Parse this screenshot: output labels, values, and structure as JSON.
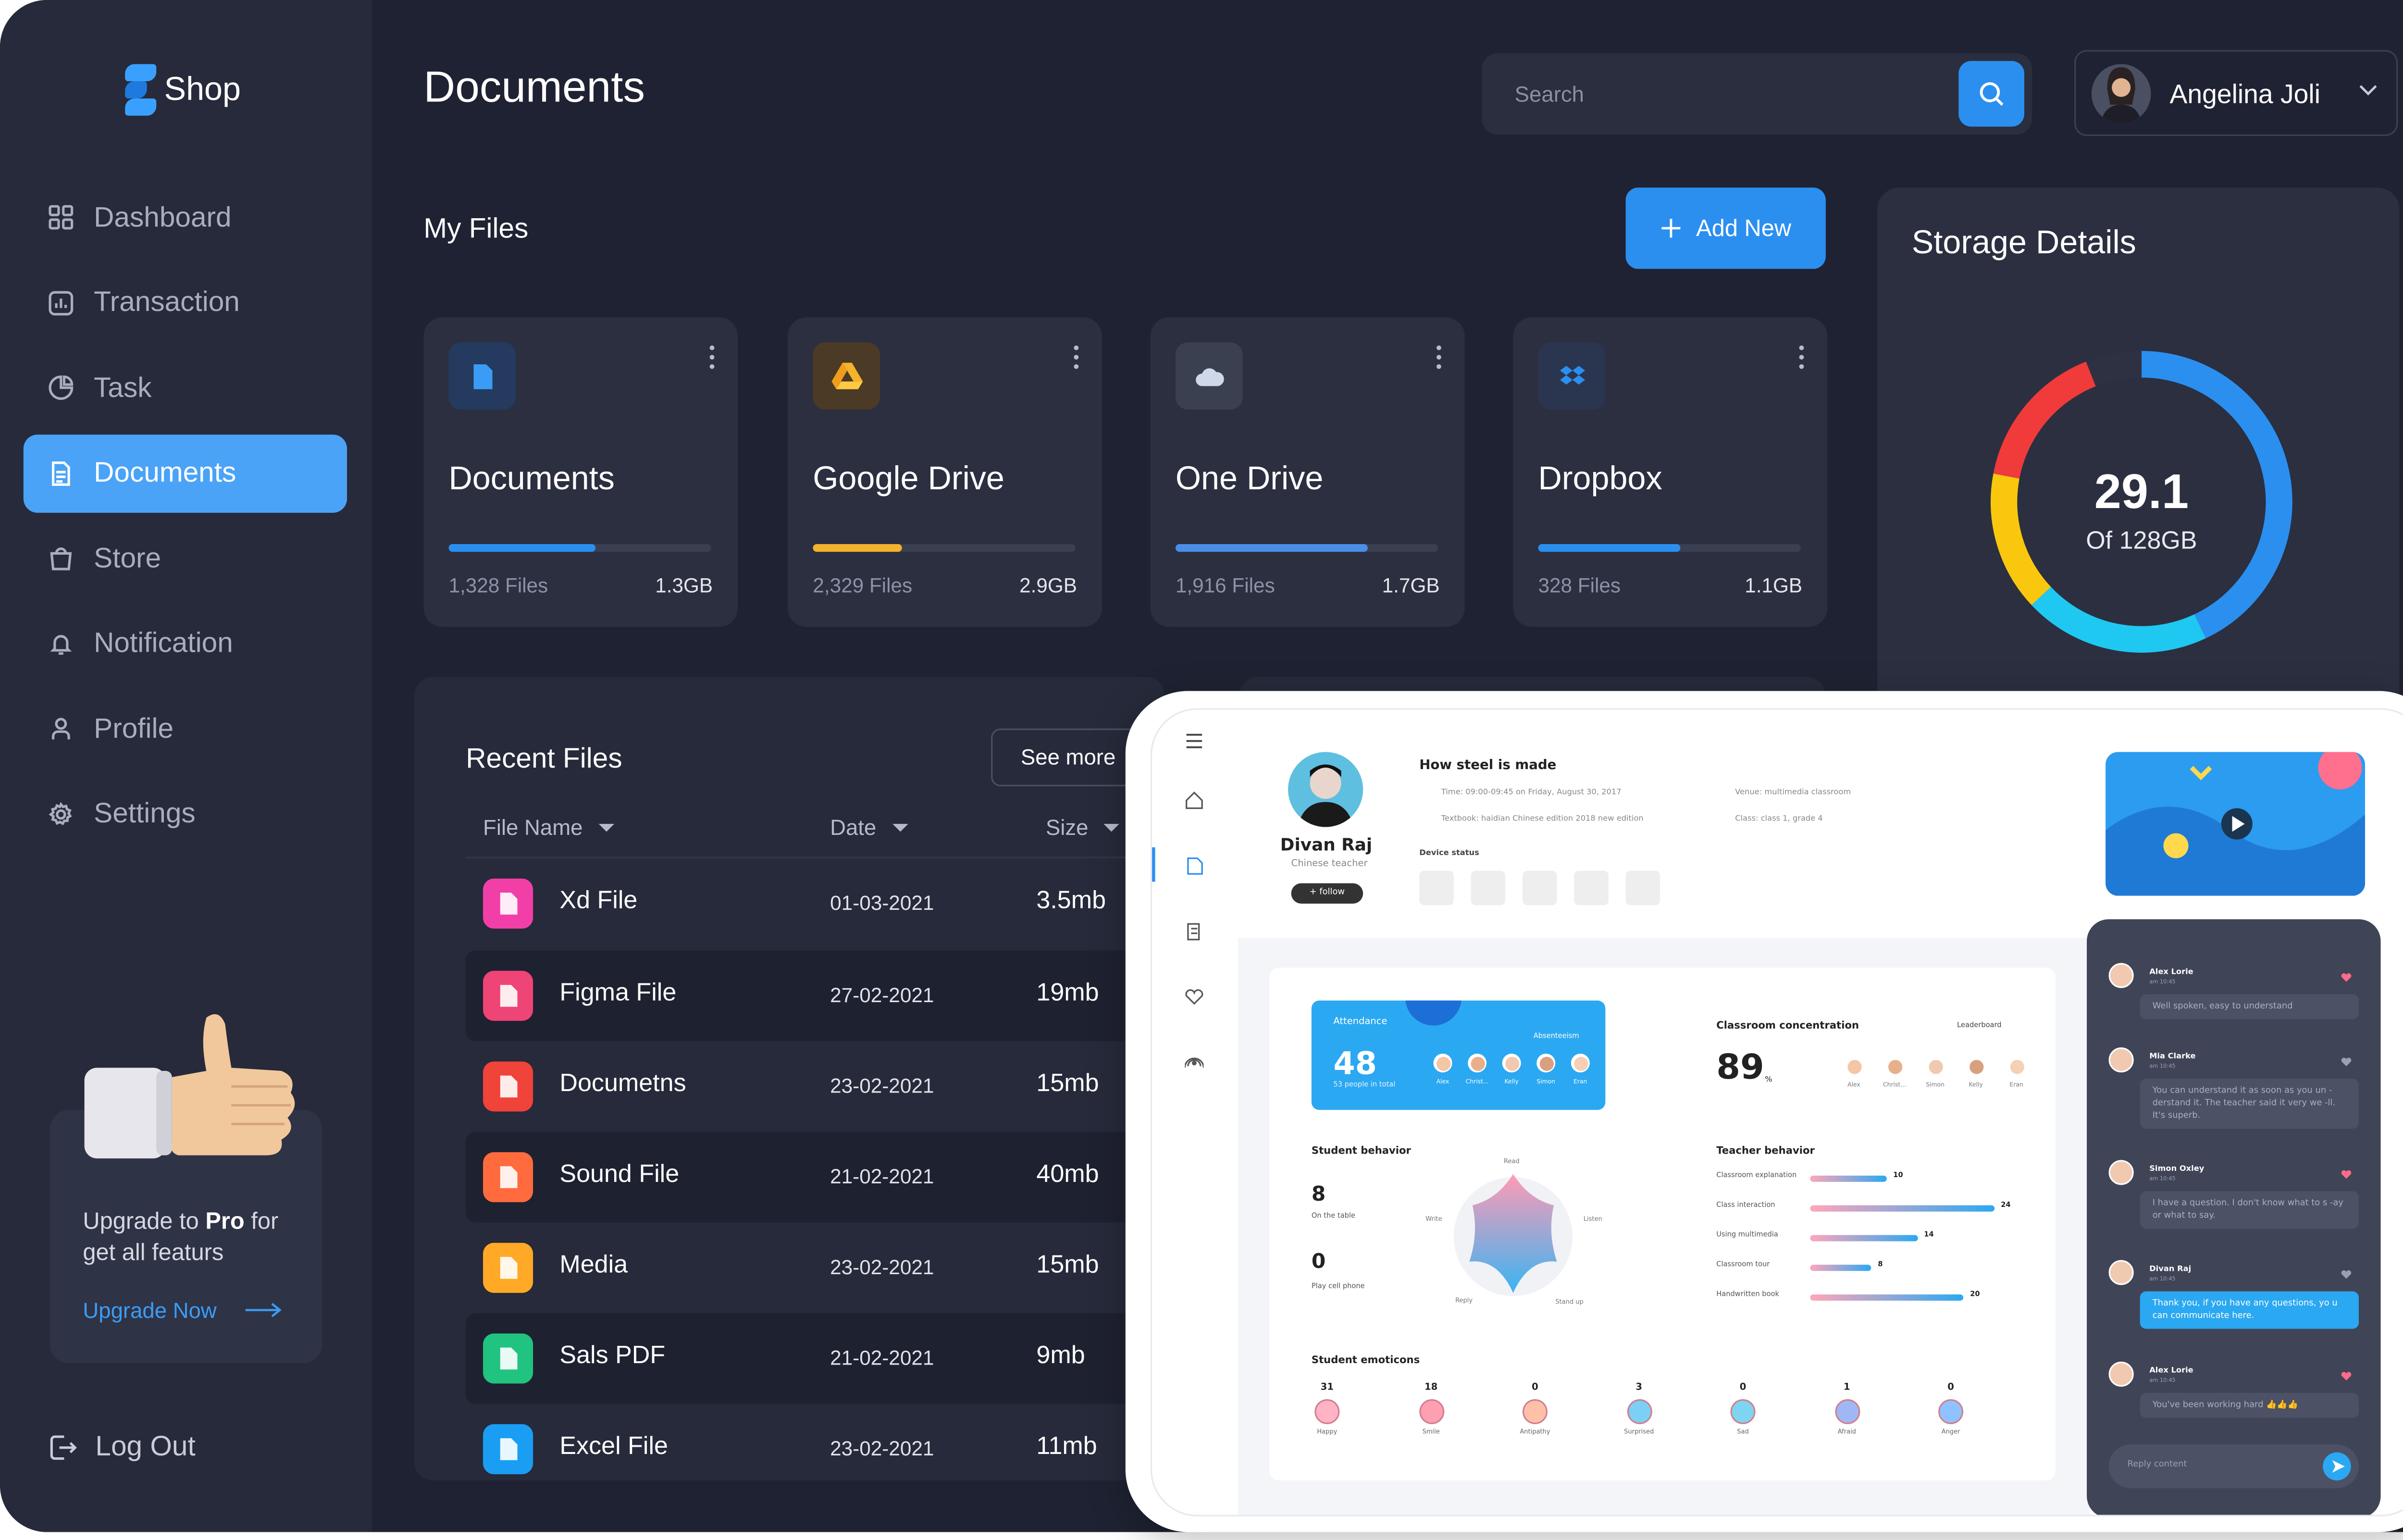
{
  "app": {
    "brand": "Shop",
    "page_title": "Documents"
  },
  "sidebar": {
    "items": [
      {
        "label": "Dashboard",
        "icon": "dashboard-icon"
      },
      {
        "label": "Transaction",
        "icon": "transaction-icon"
      },
      {
        "label": "Task",
        "icon": "task-icon"
      },
      {
        "label": "Documents",
        "icon": "document-icon",
        "active": true
      },
      {
        "label": "Store",
        "icon": "store-icon"
      },
      {
        "label": "Notification",
        "icon": "bell-icon"
      },
      {
        "label": "Profile",
        "icon": "user-icon"
      },
      {
        "label": "Settings",
        "icon": "gear-icon"
      }
    ],
    "upgrade": {
      "text_pre": "Upgrade to ",
      "text_bold": "Pro",
      "text_post": " for get all featurs",
      "link": "Upgrade Now"
    },
    "logout": "Log Out"
  },
  "header": {
    "search_placeholder": "Search",
    "user_name": "Angelina Joli"
  },
  "my_files": {
    "title": "My Files",
    "add_new": "Add New",
    "cards": [
      {
        "title": "Documents",
        "files": "1,328 Files",
        "size": "1.3GB",
        "progress": 0.56,
        "color": "#2b8ff0",
        "icon": "document-icon"
      },
      {
        "title": "Google Drive",
        "files": "2,329 Files",
        "size": "2.9GB",
        "progress": 0.34,
        "color": "#f4b22d",
        "icon": "google-drive-icon"
      },
      {
        "title": "One Drive",
        "files": "1,916 Files",
        "size": "1.7GB",
        "progress": 0.73,
        "color": "#4a8ee8",
        "icon": "cloud-icon"
      },
      {
        "title": "Dropbox",
        "files": "328 Files",
        "size": "1.1GB",
        "progress": 0.54,
        "color": "#2b8ff0",
        "icon": "dropbox-icon"
      }
    ]
  },
  "storage": {
    "title": "Storage Details",
    "used": "29.1",
    "total": "Of 128GB",
    "segments": [
      {
        "color": "#2b8ff0",
        "value": 0.43
      },
      {
        "color": "#1ec8f0",
        "value": 0.2
      },
      {
        "color": "#f9c80e",
        "value": 0.15
      },
      {
        "color": "#f13a3a",
        "value": 0.16
      },
      {
        "color": "#2d3142",
        "value": 0.06
      }
    ]
  },
  "recent": {
    "title": "Recent Files",
    "see_more": "See more",
    "columns": [
      "File Name",
      "Date",
      "Size"
    ],
    "rows": [
      {
        "name": "Xd File",
        "date": "01-03-2021",
        "size": "3.5mb",
        "color": "#f23fa8"
      },
      {
        "name": "Figma File",
        "date": "27-02-2021",
        "size": "19mb",
        "color": "#ef4476"
      },
      {
        "name": "Documetns",
        "date": "23-02-2021",
        "size": "15mb",
        "color": "#f0433a"
      },
      {
        "name": "Sound File",
        "date": "21-02-2021",
        "size": "40mb",
        "color": "#ff6b3d"
      },
      {
        "name": "Media",
        "date": "23-02-2021",
        "size": "15mb",
        "color": "#ffa927"
      },
      {
        "name": "Sals PDF",
        "date": "21-02-2021",
        "size": "9mb",
        "color": "#21c381"
      },
      {
        "name": "Excel File",
        "date": "23-02-2021",
        "size": "11mb",
        "color": "#1a9ef4"
      }
    ]
  },
  "classroom": {
    "teacher": {
      "name": "Divan Raj",
      "role": "Chinese teacher",
      "follow": "+ follow"
    },
    "lesson": {
      "title": "How steel is made",
      "time": "Time: 09:00-09:45 on Friday, August 30, 2017",
      "textbook": "Textbook: haidian Chinese edition 2018 new edition",
      "venue": "Venue: multimedia classroom",
      "class": "Class: class 1, grade 4",
      "device_status": "Device status"
    },
    "attendance": {
      "label": "Attendance",
      "value": "48",
      "sub": "53 people in total",
      "absent": "Absenteeism",
      "names": [
        "Alex",
        "Christ...",
        "Kelly",
        "Simon",
        "Eran"
      ]
    },
    "concentration": {
      "label": "Classroom concentration",
      "leaderboard": "Leaderboard",
      "value": "89",
      "unit": "%",
      "names": [
        "Alex",
        "Christ...",
        "Simon",
        "Kelly",
        "Eran"
      ]
    },
    "student_behavior": {
      "label": "Student behavior",
      "v1": "8",
      "l1": "On the table",
      "v2": "0",
      "l2": "Play cell phone",
      "axes": [
        "Read",
        "Listen",
        "Stand up",
        "Reply",
        "Write"
      ]
    },
    "teacher_behavior": {
      "label": "Teacher behavior",
      "items": [
        {
          "name": "Classroom explanation",
          "value": 10
        },
        {
          "name": "Class interaction",
          "value": 24
        },
        {
          "name": "Using multimedia",
          "value": 14
        },
        {
          "name": "Classroom tour",
          "value": 8
        },
        {
          "name": "Handwritten book",
          "value": 20
        }
      ]
    },
    "emotions": {
      "label": "Student emoticons",
      "items": [
        {
          "name": "Happy",
          "value": "31"
        },
        {
          "name": "Smile",
          "value": "18"
        },
        {
          "name": "Antipathy",
          "value": "0"
        },
        {
          "name": "Surprised",
          "value": "3"
        },
        {
          "name": "Sad",
          "value": "0"
        },
        {
          "name": "Afraid",
          "value": "1"
        },
        {
          "name": "Anger",
          "value": "0"
        }
      ]
    },
    "chat": {
      "reply_placeholder": "Reply content",
      "messages": [
        {
          "name": "Alex Lorie",
          "time": "am 10:45",
          "text": "Well spoken, easy to understand"
        },
        {
          "name": "Mia Clarke",
          "time": "am 10:45",
          "text": "You can understand it as soon as you un -derstand it. The teacher said it very we -ll. It's superb."
        },
        {
          "name": "Simon Oxley",
          "time": "am 10:45",
          "text": "I have a question. I don't know what to s -ay or what to say."
        },
        {
          "name": "Divan Raj",
          "time": "am 10:45",
          "text": "Thank you, if you have any questions, yo u can communicate here."
        },
        {
          "name": "Alex Lorie",
          "time": "am 10:45",
          "text": "You've been working hard 👍👍👍"
        }
      ]
    }
  }
}
